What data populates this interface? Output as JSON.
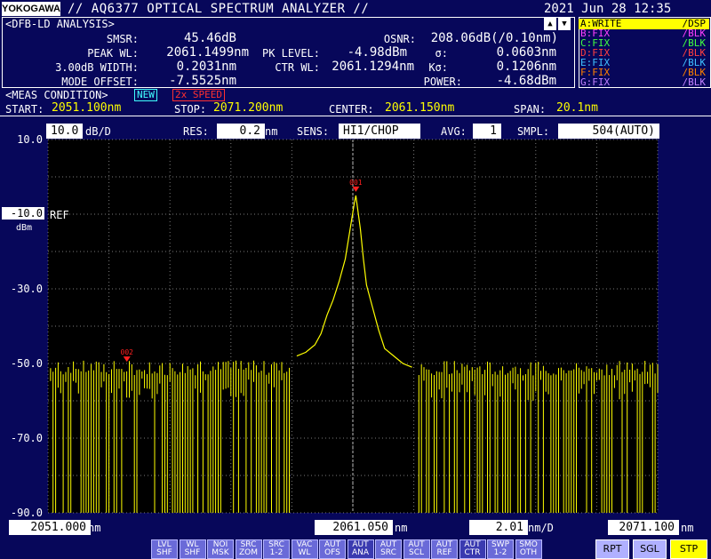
{
  "header": {
    "logo": "YOKOGAWA",
    "title": "// AQ6377 OPTICAL SPECTRUM ANALYZER //",
    "datetime": "2021 Jun 28 12:35"
  },
  "analysis": {
    "tag": "<DFB-LD ANALYSIS>",
    "smsr_label": "SMSR:",
    "smsr": "45.46dB",
    "peak_wl_label": "PEAK WL:",
    "peak_wl": "2061.1499nm",
    "width_label": "3.00dB WIDTH:",
    "width": "0.2031nm",
    "mode_offset_label": "MODE OFFSET:",
    "mode_offset": "-7.5525nm",
    "pk_level_label": "PK LEVEL:",
    "pk_level": "-4.98dBm",
    "ctr_wl_label": "CTR WL:",
    "ctr_wl": "2061.1294nm",
    "osnr_label": "OSNR:",
    "osnr": "208.06dB(/0.10nm)",
    "sigma_label": "σ:",
    "sigma": "0.0603nm",
    "ksigma_label": "Kσ:",
    "ksigma": "0.1206nm",
    "power_label": "POWER:",
    "power": "-4.68dBm"
  },
  "traces": [
    {
      "name": "A:WRITE",
      "mode": "/DSP",
      "color": "#ffff00",
      "active": true
    },
    {
      "name": "B:FIX",
      "mode": "/BLK",
      "color": "#ff40ff",
      "active": false
    },
    {
      "name": "C:FIX",
      "mode": "/BLK",
      "color": "#40ff40",
      "active": false
    },
    {
      "name": "D:FIX",
      "mode": "/BLK",
      "color": "#ff4040",
      "active": false
    },
    {
      "name": "E:FIX",
      "mode": "/BLK",
      "color": "#40c0ff",
      "active": false
    },
    {
      "name": "F:FIX",
      "mode": "/BLK",
      "color": "#ff8000",
      "active": false
    },
    {
      "name": "G:FIX",
      "mode": "/BLK",
      "color": "#c080ff",
      "active": false
    }
  ],
  "trace_arrows": {
    "up": "▲",
    "down": "▼"
  },
  "meas": {
    "tag": "<MEAS CONDITION>",
    "new_badge": "NEW",
    "speed_badge": "2x SPEED",
    "start_label": "START:",
    "start": "2051.100nm",
    "stop_label": "STOP:",
    "stop": "2071.200nm",
    "center_label": "CENTER:",
    "center": "2061.150nm",
    "span_label": "SPAN:",
    "span": "20.1nm"
  },
  "settings": {
    "scale": "10.0",
    "scale_unit": "dB/D",
    "res_label": "RES:",
    "res": "0.2",
    "res_unit": "nm",
    "sens_label": "SENS:",
    "sens": "HI1/CHOP",
    "avg_label": "AVG:",
    "avg": "1",
    "smpl_label": "SMPL:",
    "smpl": "504(AUTO)"
  },
  "yaxis": {
    "ticks": [
      "10.0",
      "-30.0",
      "-50.0",
      "-70.0",
      "-90.0"
    ],
    "ref_value": "-10.0",
    "ref_label": "REF",
    "unit": "dBm"
  },
  "markers": {
    "main": "001",
    "secondary": "002"
  },
  "bottom": {
    "start": "2051.000",
    "start_unit": "nm",
    "center": "2061.050",
    "center_unit": "nm",
    "per_div": "2.01",
    "per_div_unit": "nm/D",
    "stop": "2071.100",
    "stop_unit": "nm"
  },
  "softkeys": [
    {
      "top": "LVL",
      "bottom": "SHF"
    },
    {
      "top": "WL",
      "bottom": "SHF"
    },
    {
      "top": "NOI",
      "bottom": "MSK"
    },
    {
      "top": "SRC",
      "bottom": "ZOM"
    },
    {
      "top": "SRC",
      "bottom": "1-2"
    },
    {
      "top": "VAC",
      "bottom": "WL"
    },
    {
      "top": "AUT",
      "bottom": "OFS"
    },
    {
      "top": "AUT",
      "bottom": "ANA"
    },
    {
      "top": "AUT",
      "bottom": "SRC"
    },
    {
      "top": "AUT",
      "bottom": "SCL"
    },
    {
      "top": "AUT",
      "bottom": "REF"
    },
    {
      "top": "AUT",
      "bottom": "CTR"
    },
    {
      "top": "SWP",
      "bottom": "1-2"
    },
    {
      "top": "SMO",
      "bottom": "OTH"
    }
  ],
  "right_buttons": {
    "rpt": "RPT",
    "sgl": "SGL",
    "stp": "STP"
  },
  "chart_data": {
    "type": "line",
    "xlim": [
      2051.0,
      2071.1
    ],
    "ylim": [
      -90,
      10
    ],
    "y_ref": -10,
    "grid": true,
    "series": [
      {
        "color": "#ffff00",
        "peak": {
          "x": 2061.1499,
          "y": -4.98
        },
        "x": [
          2059.2,
          2059.5,
          2059.8,
          2060.0,
          2060.2,
          2060.4,
          2060.6,
          2060.8,
          2060.9,
          2061.0,
          2061.1,
          2061.15,
          2061.2,
          2061.3,
          2061.4,
          2061.5,
          2061.7,
          2061.9,
          2062.1,
          2062.4,
          2062.7,
          2063.0
        ],
        "y": [
          -48,
          -47,
          -45,
          -42,
          -37,
          -33,
          -28,
          -22,
          -17,
          -12,
          -7,
          -5,
          -8,
          -14,
          -22,
          -29,
          -35,
          -41,
          -46,
          -48,
          -50,
          -51
        ]
      }
    ],
    "noise_floor": -52,
    "markers": [
      {
        "label": "001",
        "x": 2061.15,
        "y": -4.98
      },
      {
        "label": "002",
        "x": 2053.6,
        "y": -50.5
      }
    ]
  }
}
